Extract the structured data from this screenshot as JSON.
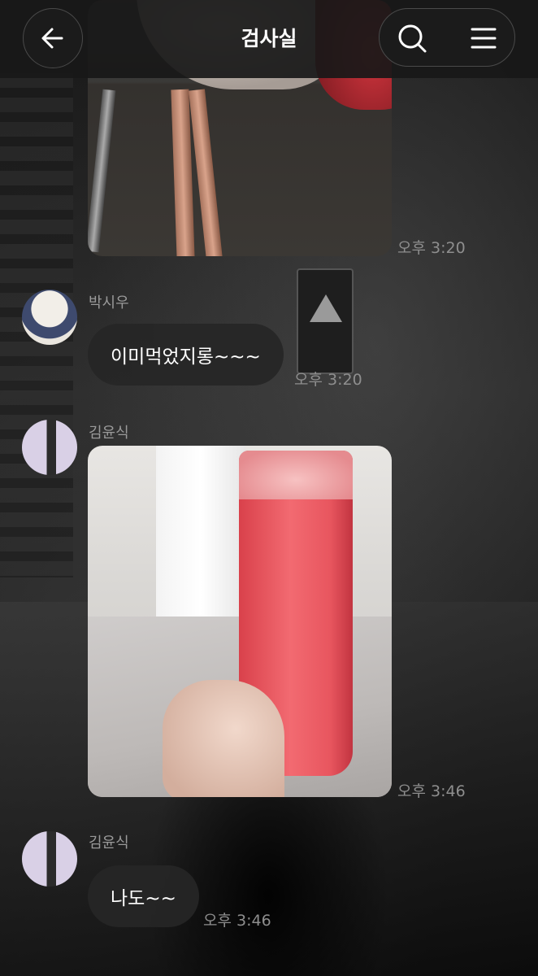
{
  "header": {
    "title": "검사실"
  },
  "messages": [
    {
      "type": "photo",
      "description": "",
      "time": "오후 3:20"
    },
    {
      "type": "text",
      "sender": "박시우",
      "text": "이미먹었지롱~~~",
      "time": "오후 3:20"
    },
    {
      "type": "photo",
      "sender": "김윤식",
      "time": "오후 3:46"
    },
    {
      "type": "text",
      "sender": "김윤식",
      "text": "나도~~",
      "time": "오후 3:46"
    }
  ],
  "icons": {
    "back": "arrow-left-icon",
    "search": "search-icon",
    "menu": "hamburger-menu-icon"
  },
  "colors": {
    "bubble_bg": "#262626",
    "text_primary": "#ffffff",
    "text_secondary": "#9a9a9a"
  }
}
